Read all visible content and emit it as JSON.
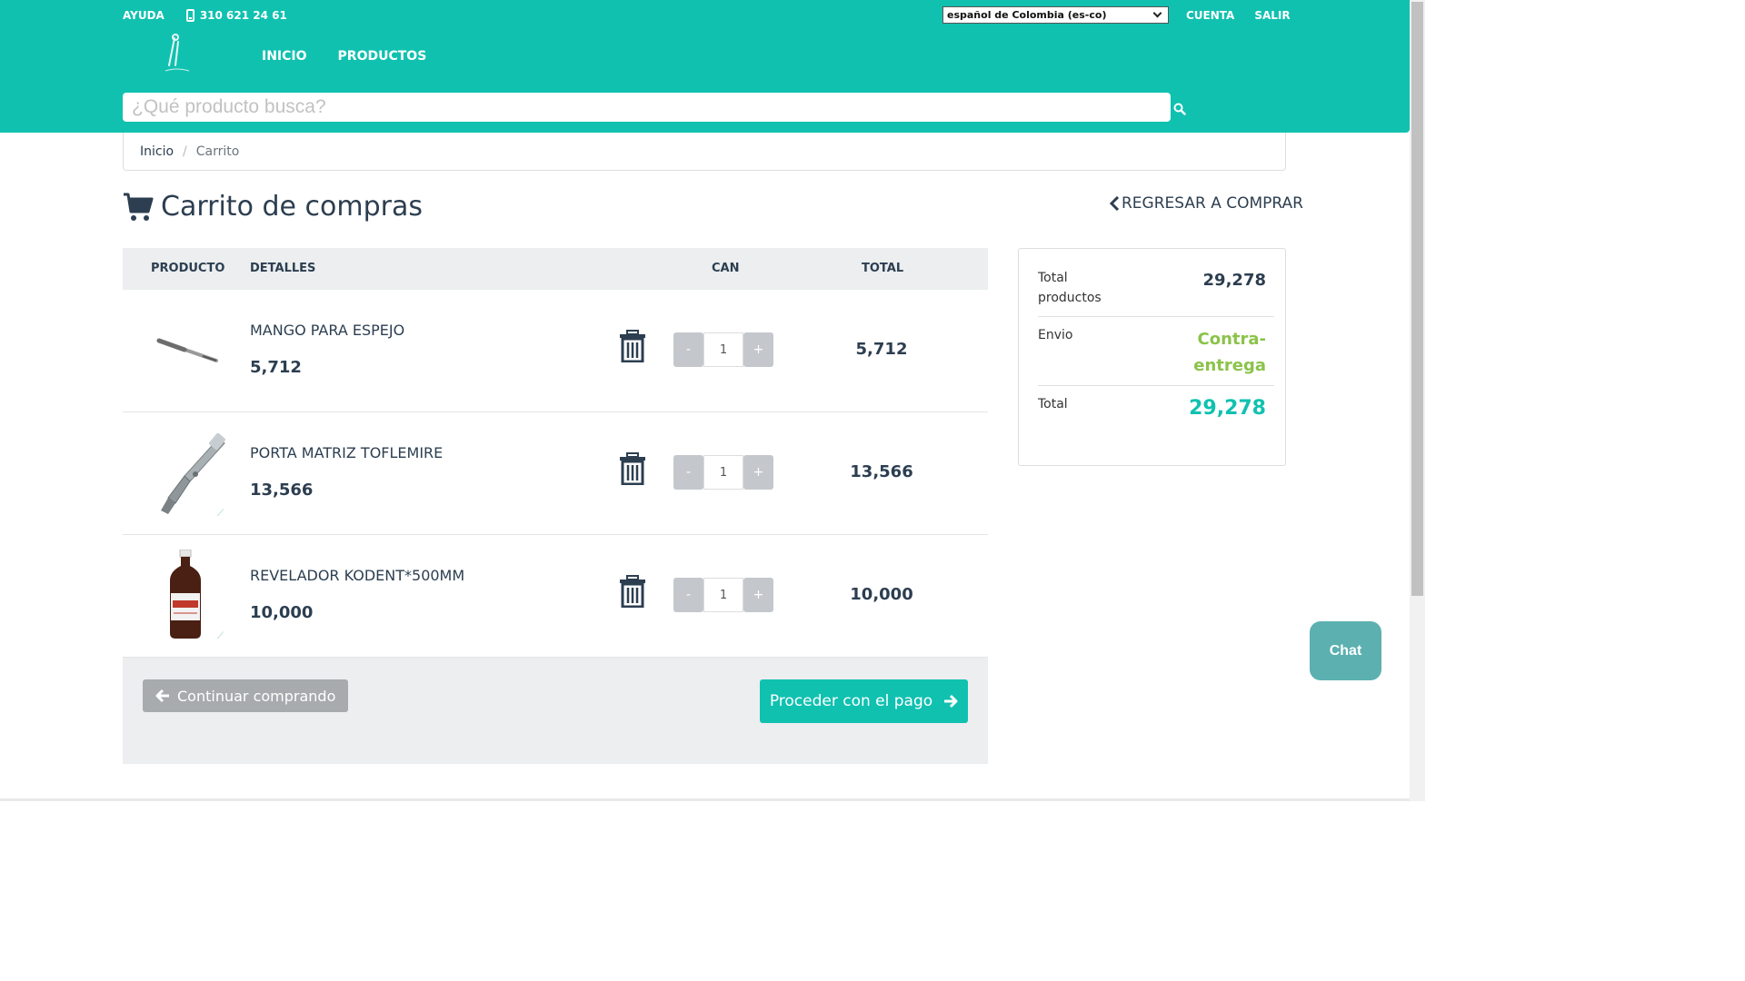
{
  "header": {
    "help_label": "AYUDA",
    "phone": "310 621 24 61",
    "language": "español de Colombia (es-co)",
    "account_label": "CUENTA",
    "logout_label": "SALIR",
    "nav": [
      {
        "label": "INICIO"
      },
      {
        "label": "PRODUCTOS"
      }
    ],
    "search_placeholder": "¿Qué producto busca?",
    "accent_color": "#10c1b0"
  },
  "breadcrumb": {
    "home": "Inicio",
    "current": "Carrito"
  },
  "cart": {
    "title": "Carrito de compras",
    "back_label": "REGRESAR A COMPRAR",
    "columns": {
      "product": "PRODUCTO",
      "details": "DETALLES",
      "quantity": "CAN",
      "total": "TOTAL"
    },
    "items": [
      {
        "name": "MANGO PARA ESPEJO",
        "price": "5,712",
        "qty": "1",
        "total": "5,712",
        "icon": "mirror-handle-image"
      },
      {
        "name": "PORTA MATRIZ TOFLEMIRE",
        "price": "13,566",
        "qty": "1",
        "total": "13,566",
        "icon": "matrix-retainer-image"
      },
      {
        "name": "REVELADOR KODENT*500MM",
        "price": "10,000",
        "qty": "1",
        "total": "10,000",
        "icon": "developer-bottle-image"
      }
    ],
    "qty_minus": "-",
    "qty_plus": "+",
    "continue_label": "Continuar comprando",
    "pay_label": "Proceder con el pago"
  },
  "summary": {
    "products_label": "Total productos",
    "products_value": "29,278",
    "shipping_label": "Envio",
    "shipping_value": "Contra-entrega",
    "total_label": "Total",
    "total_value": "29,278",
    "shipping_color": "#8bc34a",
    "total_color": "#10c1b0"
  },
  "chat": {
    "label": "Chat"
  }
}
